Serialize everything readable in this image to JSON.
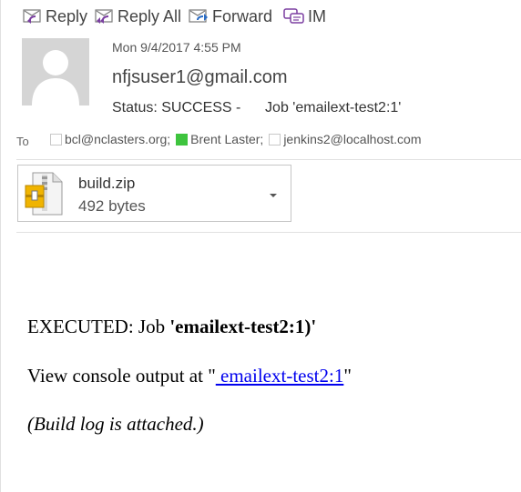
{
  "toolbar": {
    "reply_label": "Reply",
    "reply_all_label": "Reply All",
    "forward_label": "Forward",
    "im_label": "IM"
  },
  "message": {
    "date": "Mon 9/4/2017 4:55 PM",
    "from": "nfjsuser1@gmail.com",
    "subject_prefix": "Status: SUCCESS -",
    "subject_job": "Job 'emailext-test2:1'",
    "to_label": "To",
    "recipients": [
      {
        "name": "bcl@nclasters.org;",
        "presence": false
      },
      {
        "name": "Brent Laster;",
        "presence": true
      },
      {
        "name": "jenkins2@localhost.com",
        "presence": false
      }
    ]
  },
  "attachment": {
    "name": "build.zip",
    "size": "492 bytes",
    "icon": "zip-archive-icon"
  },
  "body": {
    "line1_prefix": "EXECUTED: Job ",
    "line1_bold": "'emailext-test2:1)'",
    "line2_prefix": "View console output at \"",
    "line2_link": " emailext-test2:1",
    "line2_suffix": "\"",
    "line3": "(Build log is attached.)"
  },
  "colors": {
    "presence_available": "#3ec43e",
    "link": "#0000ee",
    "icon_purple": "#7b3fa1",
    "icon_blue": "#2b6cc4"
  }
}
